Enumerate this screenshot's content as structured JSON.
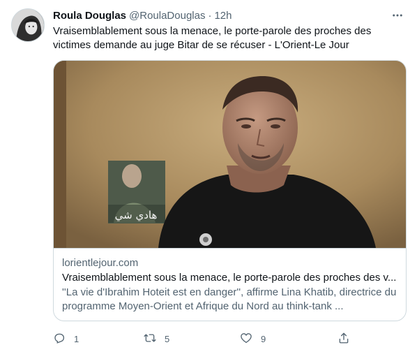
{
  "tweet": {
    "author_name": "Roula Douglas",
    "author_handle": "@RoulaDouglas",
    "separator": "·",
    "time": "12h",
    "text": "Vraisemblablement sous la menace, le porte-parole des proches des victimes demande au juge Bitar de se récuser - L'Orient-Le Jour"
  },
  "card": {
    "domain": "lorientlejour.com",
    "title": "Vraisemblablement sous la menace, le porte-parole des proches des v...",
    "description": "''La vie d'Ibrahim Hoteit est en danger'', affirme Lina Khatib, directrice du programme Moyen-Orient et Afrique du Nord au think-tank ...",
    "image_poster_text": "ﻫﺎدي ﺷﻲ"
  },
  "actions": {
    "reply_count": "1",
    "retweet_count": "5",
    "like_count": "9",
    "icons": [
      "reply-icon",
      "retweet-icon",
      "like-icon",
      "share-icon"
    ]
  },
  "colors": {
    "text_primary": "#0f1419",
    "text_secondary": "#536471",
    "border": "#cfd9de"
  }
}
